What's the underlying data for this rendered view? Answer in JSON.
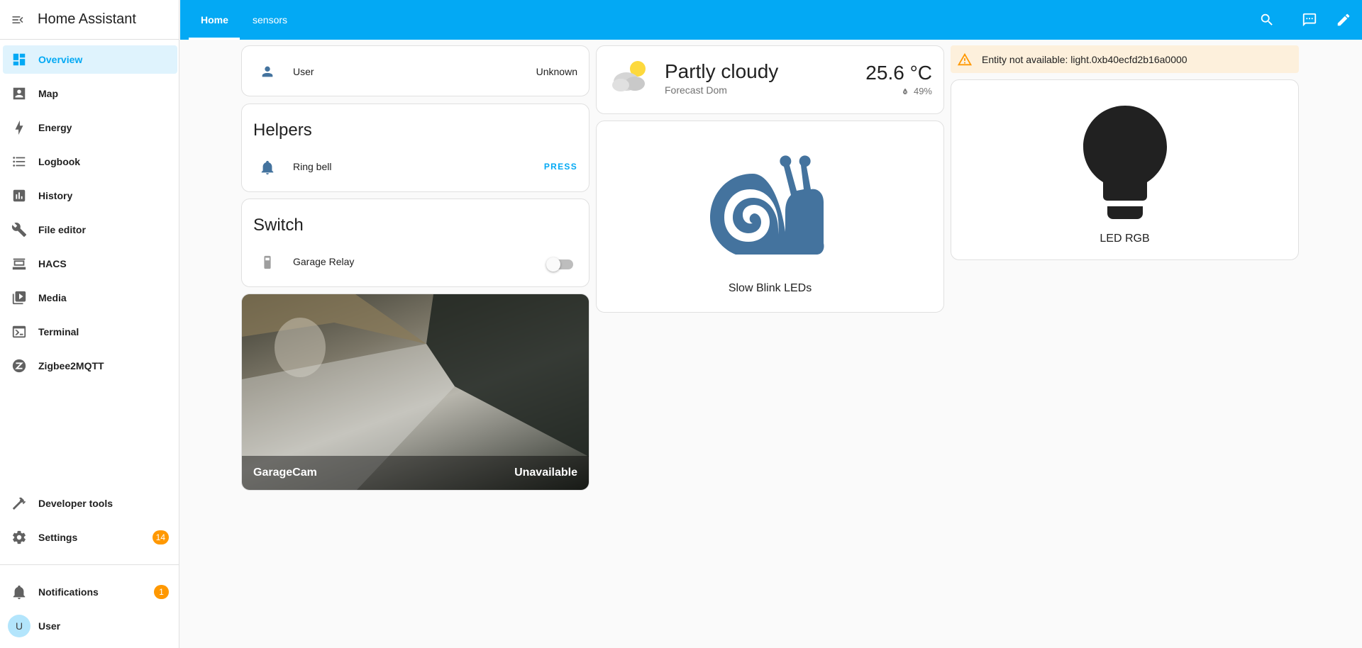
{
  "app": {
    "title": "Home Assistant"
  },
  "sidebar": {
    "items": [
      {
        "label": "Overview",
        "icon": "view-dashboard-icon",
        "active": true
      },
      {
        "label": "Map",
        "icon": "map-icon"
      },
      {
        "label": "Energy",
        "icon": "lightning-bolt-icon"
      },
      {
        "label": "Logbook",
        "icon": "format-list-icon"
      },
      {
        "label": "History",
        "icon": "chart-box-icon"
      },
      {
        "label": "File editor",
        "icon": "wrench-icon"
      },
      {
        "label": "HACS",
        "icon": "hacs-icon"
      },
      {
        "label": "Media",
        "icon": "play-box-multiple-icon"
      },
      {
        "label": "Terminal",
        "icon": "console-icon"
      },
      {
        "label": "Zigbee2MQTT",
        "icon": "zigbee-icon"
      }
    ],
    "developer_tools": {
      "label": "Developer tools",
      "icon": "hammer-icon"
    },
    "settings": {
      "label": "Settings",
      "icon": "cog-icon",
      "badge": "14"
    },
    "notifications": {
      "label": "Notifications",
      "icon": "bell-icon",
      "badge": "1"
    },
    "user": {
      "label": "User",
      "initial": "U"
    }
  },
  "topbar": {
    "tabs": [
      {
        "label": "Home",
        "active": true
      },
      {
        "label": "sensors",
        "active": false
      }
    ],
    "icons": [
      "search-icon",
      "assist-chat-icon",
      "pencil-icon"
    ]
  },
  "cards": {
    "user_entity": {
      "name": "User",
      "state": "Unknown"
    },
    "helpers": {
      "title": "Helpers",
      "row": {
        "name": "Ring bell",
        "action": "PRESS"
      }
    },
    "switch": {
      "title": "Switch",
      "row": {
        "name": "Garage Relay",
        "state": "off"
      }
    },
    "camera": {
      "name": "GarageCam",
      "state": "Unavailable"
    },
    "weather": {
      "condition": "Partly cloudy",
      "name": "Forecast Dom",
      "temperature": "25.6 °C",
      "humidity": "49%"
    },
    "snail_button": {
      "name": "Slow Blink LEDs"
    },
    "warning": {
      "text": "Entity not available: light.0xb40ecfd2b16a0000"
    },
    "light_button": {
      "name": "LED RGB"
    }
  },
  "colors": {
    "primary": "#03a9f4",
    "icon_blue": "#44739e",
    "badge": "#ff9800",
    "warning_bg": "#fdf0dc",
    "warning_icon": "#ff9800"
  }
}
